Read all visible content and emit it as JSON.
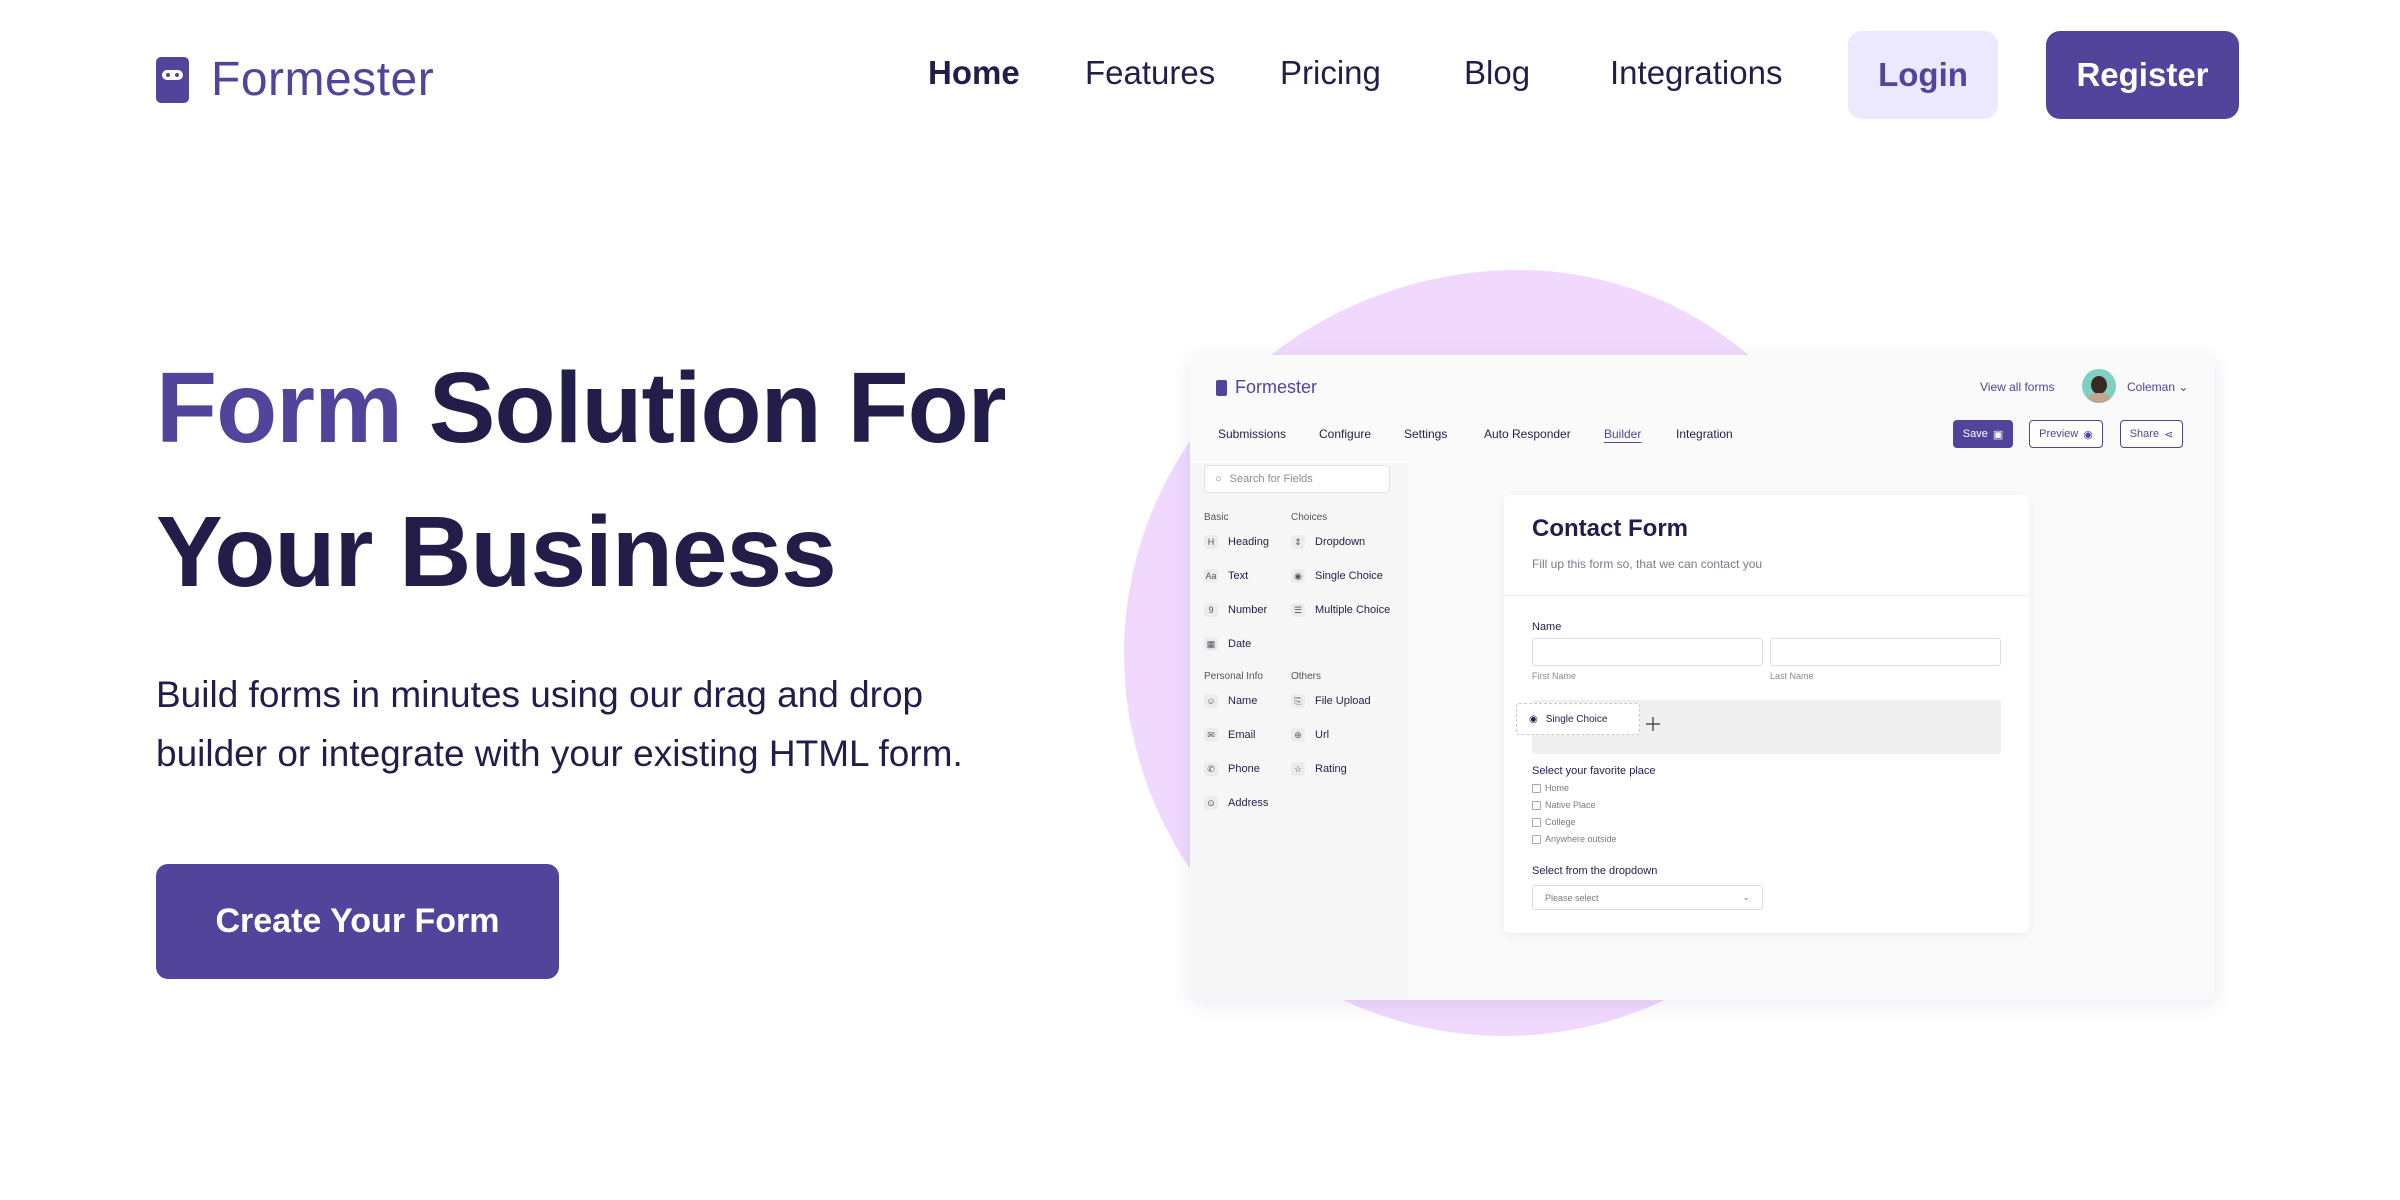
{
  "header": {
    "logo_text": "Formester",
    "nav": [
      "Home",
      "Features",
      "Pricing",
      "Blog",
      "Integrations"
    ],
    "login_label": "Login",
    "register_label": "Register"
  },
  "hero": {
    "title_accent": "Form",
    "title_line1_rest": "Solution For",
    "title_line2": "Your Business",
    "subtitle": "Build forms in minutes using our drag and drop builder or integrate with your existing HTML form.",
    "cta_label": "Create Your Form"
  },
  "app": {
    "logo_text": "Formester",
    "view_all": "View all forms",
    "user_name": "Coleman",
    "tabs": [
      "Submissions",
      "Configure",
      "Settings",
      "Auto Responder",
      "Builder",
      "Integration"
    ],
    "active_tab": "Builder",
    "buttons": {
      "save": "Save",
      "preview": "Preview",
      "share": "Share"
    },
    "search_placeholder": "Search for Fields",
    "groups": {
      "basic": {
        "label": "Basic",
        "items": [
          "Heading",
          "Text",
          "Number",
          "Date"
        ]
      },
      "choices": {
        "label": "Choices",
        "items": [
          "Dropdown",
          "Single Choice",
          "Multiple Choice"
        ]
      },
      "personal": {
        "label": "Personal Info",
        "items": [
          "Name",
          "Email",
          "Phone",
          "Address"
        ]
      },
      "others": {
        "label": "Others",
        "items": [
          "File Upload",
          "Url",
          "Rating"
        ]
      }
    },
    "form": {
      "title": "Contact Form",
      "description": "Fill up this form so, that we can contact you",
      "name_label": "Name",
      "first_name": "First Name",
      "last_name": "Last Name",
      "dragging_item": "Single Choice",
      "place_label": "Select your favorite place",
      "place_options": [
        "Home",
        "Native Place",
        "College",
        "Anywhere outside"
      ],
      "dropdown_label": "Select from the dropdown",
      "dropdown_placeholder": "Please select"
    }
  },
  "colors": {
    "brand": "#51449a",
    "dark": "#231d4a",
    "login_bg": "#ece8fd",
    "blob": "#f0d9fd"
  }
}
